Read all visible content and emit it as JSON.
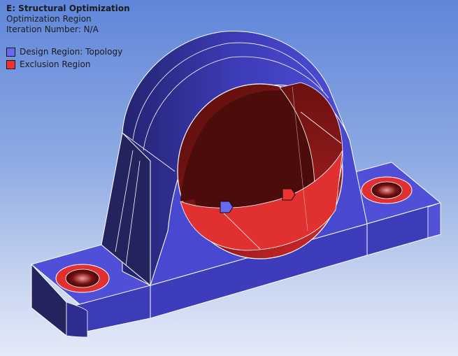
{
  "header": {
    "title": "E: Structural Optimization",
    "subtitle": "Optimization Region",
    "iteration": "Iteration Number: N/A"
  },
  "legend": {
    "items": [
      {
        "label": "Design Region: Topology",
        "color": "#6a6af0"
      },
      {
        "label": "Exclusion Region",
        "color": "#f03232"
      }
    ]
  },
  "colors": {
    "design_face": "#4b4bd8",
    "design_dark": "#2a2a7a",
    "design_side": "#3a3ab8",
    "exclusion": "#e03030",
    "exclusion_dark": "#5a0f0f",
    "background_top": "#5f86d9",
    "background_bottom": "#e4eaf8"
  }
}
